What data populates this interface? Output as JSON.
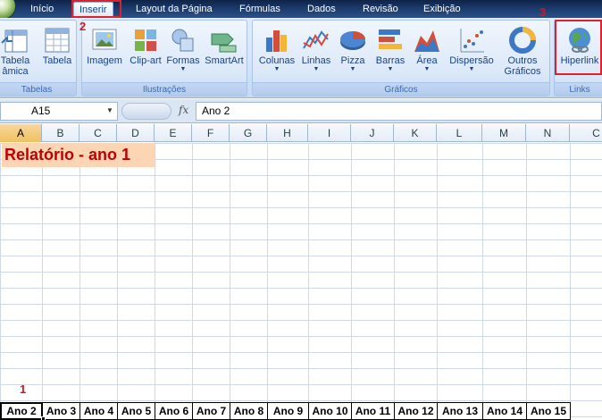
{
  "menu": {
    "tabs": [
      "Início",
      "Inserir",
      "Layout da Página",
      "Fórmulas",
      "Dados",
      "Revisão",
      "Exibição"
    ]
  },
  "steps": {
    "s1": "1",
    "s2": "2",
    "s3": "3"
  },
  "ribbon": {
    "groups": {
      "tabelas": "Tabelas",
      "ilustracoes": "Ilustrações",
      "graficos": "Gráficos",
      "links": "Links"
    },
    "buttons": {
      "tabela_dinamica_1": "Tabela",
      "tabela_dinamica_2": "âmica",
      "tabela": "Tabela",
      "imagem": "Imagem",
      "clipart": "Clip-art",
      "formas": "Formas",
      "smartart": "SmartArt",
      "colunas": "Colunas",
      "linhas": "Linhas",
      "pizza": "Pizza",
      "barras": "Barras",
      "area": "Área",
      "dispersao": "Dispersão",
      "outros_1": "Outros",
      "outros_2": "Gráficos",
      "hiperlink": "Hiperlink"
    }
  },
  "formula_bar": {
    "name_box": "A15",
    "fx": "fx",
    "content": "Ano 2"
  },
  "columns": [
    "A",
    "B",
    "C",
    "D",
    "E",
    "F",
    "G",
    "H",
    "I",
    "J",
    "K",
    "L",
    "M",
    "N",
    "C"
  ],
  "sheet": {
    "title": "Relatório - ano 1",
    "years": [
      "Ano 2",
      "Ano 3",
      "Ano 4",
      "Ano 5",
      "Ano 6",
      "Ano 7",
      "Ano 8",
      "Ano 9",
      "Ano 10",
      "Ano 11",
      "Ano 12",
      "Ano 13",
      "Ano 14",
      "Ano 15"
    ]
  }
}
